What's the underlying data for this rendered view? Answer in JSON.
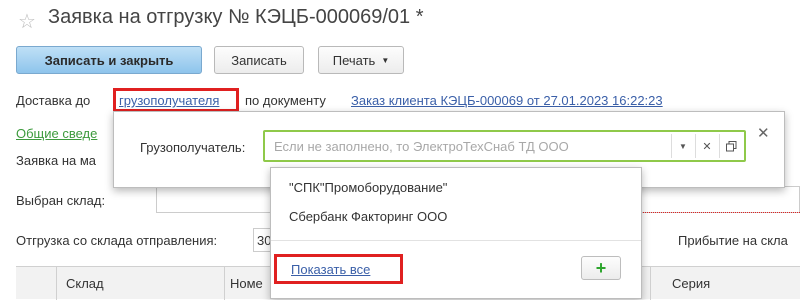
{
  "window": {
    "title": "Заявка на отгрузку № КЭЦБ-000069/01 *"
  },
  "toolbar": {
    "save_close_label": "Записать и закрыть",
    "save_label": "Записать",
    "print_label": "Печать"
  },
  "delivery": {
    "prefix": "Доставка до",
    "consignee_link": "грузополучателя",
    "by_document": "по документу",
    "order_link": "Заказ клиента КЭЦБ-000069 от 27.01.2023 16:22:23"
  },
  "background": {
    "general_info_link": "Общие сведе",
    "request_label": "Заявка на ма",
    "warehouse_selected_label": "Выбран склад:",
    "ship_from_label": "Отгрузка со склада отправления:",
    "ship_from_value": "30",
    "arrival_label": "Прибытие на скла"
  },
  "grid": {
    "columns": [
      "Склад",
      "Номе",
      "Серия"
    ]
  },
  "popup": {
    "consignee_label": "Грузополучатель:",
    "consignee_placeholder": "Если не заполнено, то ЭлектроТехСнаб ТД ООО"
  },
  "dropdown": {
    "items": [
      "\"СПК\"Промоборудование\"",
      "Сбербанк Факторинг ООО"
    ],
    "show_all_link": "Показать все"
  },
  "colors": {
    "highlight": "#e02020",
    "focus_border": "#8fc94a",
    "primary_button": "#8ec4ec"
  }
}
